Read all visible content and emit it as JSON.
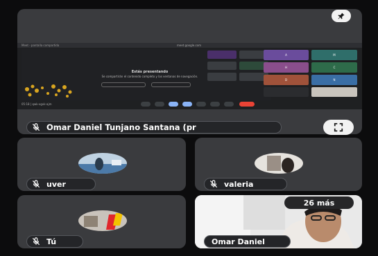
{
  "presenter": {
    "name": "Omar Daniel Tunjano Santana (pr",
    "shared_screen": {
      "address_text": "Meet - pantalla compartida",
      "url_text": "meet.google.com",
      "title": "Estás presentando",
      "body": "Se compartirán el contenido completo y las ventanas de navegación.",
      "status_text": "05:18  |  qwk-xgvk-ajm",
      "tiles": [
        "A",
        "M",
        "H",
        "C",
        "D",
        "N"
      ]
    }
  },
  "participants": [
    {
      "name": "uver"
    },
    {
      "name": "valeria"
    },
    {
      "name": "Tú"
    },
    {
      "name": "Omar Daniel"
    }
  ],
  "more_count": "26 más",
  "icons": {
    "pin": "pin-icon",
    "fullscreen": "fullscreen-icon",
    "mic_off": "mic-off-icon"
  },
  "colors": {
    "background": "#0c0c0d",
    "tile": "#3a3b3e",
    "pill": "#242528"
  }
}
